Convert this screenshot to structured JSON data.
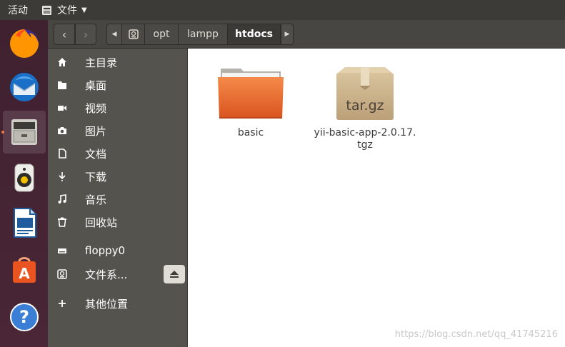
{
  "topbar": {
    "activities": "活动",
    "app_name": "文件"
  },
  "dock": {
    "items": [
      {
        "name": "firefox-icon"
      },
      {
        "name": "thunderbird-icon"
      },
      {
        "name": "files-icon"
      },
      {
        "name": "rhythmbox-icon"
      },
      {
        "name": "libreoffice-writer-icon"
      },
      {
        "name": "software-center-icon"
      },
      {
        "name": "help-icon"
      }
    ],
    "running_color": "#f07746"
  },
  "breadcrumbs": [
    "opt",
    "lampp",
    "htdocs"
  ],
  "sidebar": {
    "items": [
      {
        "label": "主目录",
        "icon": "home-icon"
      },
      {
        "label": "桌面",
        "icon": "folder-icon"
      },
      {
        "label": "视频",
        "icon": "video-icon"
      },
      {
        "label": "图片",
        "icon": "camera-icon"
      },
      {
        "label": "文档",
        "icon": "document-icon"
      },
      {
        "label": "下载",
        "icon": "download-icon"
      },
      {
        "label": "音乐",
        "icon": "music-icon"
      },
      {
        "label": "回收站",
        "icon": "trash-icon"
      },
      {
        "label": "floppy0",
        "icon": "drive-icon"
      },
      {
        "label": "文件系...",
        "icon": "filesystem-icon"
      },
      {
        "label": "其他位置",
        "icon": "plus-icon"
      }
    ]
  },
  "files": [
    {
      "name": "basic",
      "type": "folder"
    },
    {
      "name": "yii-basic-app-2.0.17.\ntgz",
      "type": "archive",
      "badge": "tar.gz"
    }
  ],
  "watermark": "https://blog.csdn.net/qq_41745216",
  "colors": {
    "accent": "#e95420",
    "sidebar": "#54534e",
    "dock": "#4a2636"
  }
}
